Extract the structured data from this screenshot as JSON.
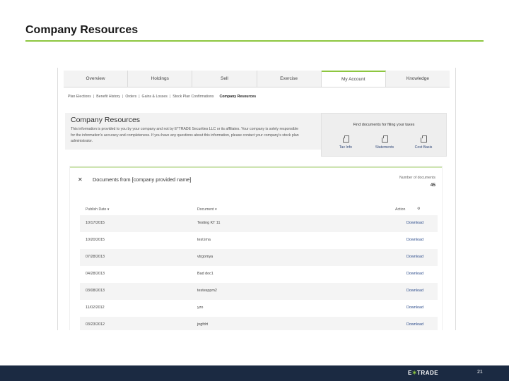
{
  "slide": {
    "title": "Company Resources",
    "page_number": "21",
    "logo_pre": "E",
    "logo_star": "✶",
    "logo_post": "TRADE"
  },
  "tabs": [
    "Overview",
    "Holdings",
    "Sell",
    "Exercise",
    "My Account",
    "Knowledge"
  ],
  "subnav": [
    "Plan Elections",
    "Benefit History",
    "Orders",
    "Gains & Losses",
    "Stock Plan Confirmations",
    "Company Resources"
  ],
  "header": {
    "title": "Company Resources",
    "description": "This information is provided to you by your company and not by E*TRADE Securities LLC or its affiliates. Your company is solely responsible for the information's accuracy and completeness. If you have any questions about this information, please contact your company's stock plan administrator."
  },
  "tax": {
    "title": "Find documents for filing your taxes",
    "links": [
      "Tax Info",
      "Statements",
      "Cost Basis"
    ]
  },
  "documents": {
    "title": "Documents from [company provided name]",
    "count_label": "Number of documents",
    "count": "45",
    "columns": {
      "date": "Publish Date ▾",
      "doc": "Document ▾",
      "action": "Action"
    },
    "rows": [
      {
        "date": "10/17/2015",
        "doc": "Testing KT 11",
        "action": "Download"
      },
      {
        "date": "10/20/2015",
        "doc": "test.ima",
        "action": "Download"
      },
      {
        "date": "07/28/2013",
        "doc": "vtrgomya",
        "action": "Download"
      },
      {
        "date": "04/28/2013",
        "doc": "Bad doc1",
        "action": "Download"
      },
      {
        "date": "03/08/2013",
        "doc": "testesppm2",
        "action": "Download"
      },
      {
        "date": "11/02/2012",
        "doc": "yzo",
        "action": "Download"
      },
      {
        "date": "03/23/2012",
        "doc": "jngfdrt",
        "action": "Download"
      }
    ]
  }
}
